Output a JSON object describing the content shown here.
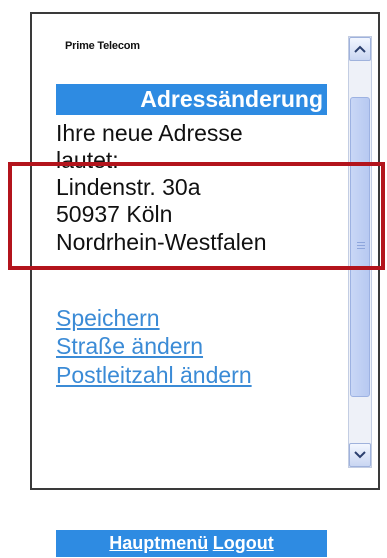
{
  "header": {
    "brand": "Prime Telecom",
    "title": "Adressänderung"
  },
  "main": {
    "intro_line1": "Ihre neue Adresse",
    "intro_line2": "lautet:",
    "address": {
      "street": "Lindenstr. 30a",
      "city": "50937 Köln",
      "state": "Nordrhein-Westfalen"
    },
    "links": [
      "Speichern",
      "Straße ändern",
      "Postleitzahl ändern"
    ]
  },
  "footer": {
    "menu_label": "Hauptmenü",
    "logout_label": "Logout"
  },
  "colors": {
    "accent": "#2e8be2",
    "link": "#3b8bd6",
    "highlight": "#b3141c"
  },
  "icons": {
    "scroll_up": "chevron-up-icon",
    "scroll_down": "chevron-down-icon"
  }
}
